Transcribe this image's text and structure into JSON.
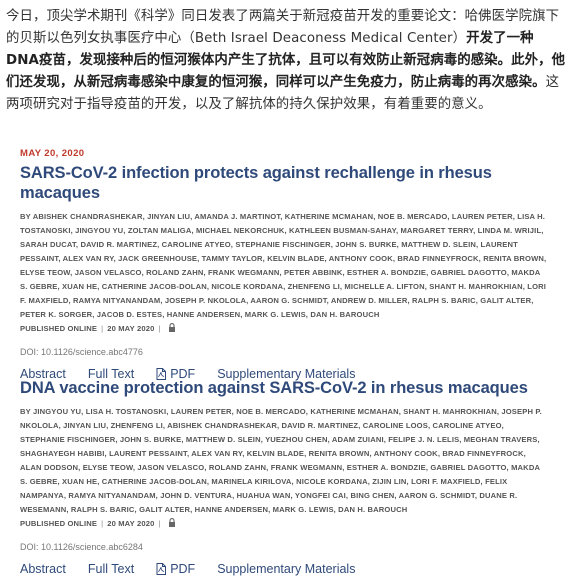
{
  "intro": {
    "part1": "今日，顶尖学术期刊《科学》同日发表了两篇关于新冠疫苗开发的重要论文：哈佛医学院旗下的贝斯以色列女执事医疗中心（Beth Israel Deaconess Medical Center）",
    "bold1": "开发了一种DNA疫苗，发现接种后的恒河猴体内产生了抗体，且可以有效防止新冠病毒的感染。此外，他们还发现，从新冠病毒感染中康复的恒河猴，同样可以产生免疫力，防止病毒的再次感染。",
    "part2": "这两项研究对于指导疫苗的开发，以及了解抗体的持久保护效果，有着重要的意义。"
  },
  "articles": [
    {
      "date": "MAY 20, 2020",
      "title": "SARS-CoV-2 infection protects against rechallenge in rhesus macaques",
      "authors": "BY ABISHEK CHANDRASHEKAR, JINYAN LIU, AMANDA J. MARTINOT, KATHERINE MCMAHAN, NOE B. MERCADO, LAUREN PETER, LISA H. TOSTANOSKI, JINGYOU YU, ZOLTAN MALIGA, MICHAEL NEKORCHUK, KATHLEEN BUSMAN-SAHAY, MARGARET TERRY, LINDA M. WRIJIL, SARAH DUCAT, DAVID R. MARTINEZ, CAROLINE ATYEO, STEPHANIE FISCHINGER, JOHN S. BURKE, MATTHEW D. SLEIN, LAURENT PESSAINT, ALEX VAN RY, JACK GREENHOUSE, TAMMY TAYLOR, KELVIN BLADE, ANTHONY COOK, BRAD FINNEYFROCK, RENITA BROWN, ELYSE TEOW, JASON VELASCO, ROLAND ZAHN, FRANK WEGMANN, PETER ABBINK, ESTHER A. BONDZIE, GABRIEL DAGOTTO, MAKDA S. GEBRE, XUAN HE, CATHERINE JACOB-DOLAN, NICOLE KORDANA, ZHENFENG LI, MICHELLE A. LIFTON, SHANT H. MAHROKHIAN, LORI F. MAXFIELD, RAMYA NITYANANDAM, JOSEPH P. NKOLOLA, AARON G. SCHMIDT, ANDREW D. MILLER, RALPH S. BARIC, GALIT ALTER, PETER K. SORGER, JACOB D. ESTES, HANNE ANDERSEN, MARK G. LEWIS, DAN H. BAROUCH",
      "published_label": "PUBLISHED ONLINE",
      "published_date": "20 MAY 2020",
      "doi": "DOI: 10.1126/science.abc4776",
      "links": {
        "abstract": "Abstract",
        "fulltext": "Full Text",
        "pdf": "PDF",
        "supp": "Supplementary Materials"
      }
    },
    {
      "title": "DNA vaccine protection against SARS-CoV-2 in rhesus macaques",
      "authors": "BY JINGYOU YU, LISA H. TOSTANOSKI, LAUREN PETER, NOE B. MERCADO, KATHERINE MCMAHAN, SHANT H. MAHROKHIAN, JOSEPH P. NKOLOLA, JINYAN LIU, ZHENFENG LI, ABISHEK CHANDRASHEKAR, DAVID R. MARTINEZ, CAROLINE LOOS, CAROLINE ATYEO, STEPHANIE FISCHINGER, JOHN S. BURKE, MATTHEW D. SLEIN, YUEZHOU CHEN, ADAM ZUIANI, FELIPE J. N. LELIS, MEGHAN TRAVERS, SHAGHAYEGH HABIBI, LAURENT PESSAINT, ALEX VAN RY, KELVIN BLADE, RENITA BROWN, ANTHONY COOK, BRAD FINNEYFROCK, ALAN DODSON, ELYSE TEOW, JASON VELASCO, ROLAND ZAHN, FRANK WEGMANN, ESTHER A. BONDZIE, GABRIEL DAGOTTO, MAKDA S. GEBRE, XUAN HE, CATHERINE JACOB-DOLAN, MARINELA KIRILOVA, NICOLE KORDANA, ZIJIN LIN, LORI F. MAXFIELD, FELIX NAMPANYA, RAMYA NITYANANDAM, JOHN D. VENTURA, HUAHUA WAN, YONGFEI CAI, BING CHEN, AARON G. SCHMIDT, DUANE R. WESEMANN, RALPH S. BARIC, GALIT ALTER, HANNE ANDERSEN, MARK G. LEWIS, DAN H. BAROUCH",
      "published_label": "PUBLISHED ONLINE",
      "published_date": "20 MAY 2020",
      "doi": "DOI: 10.1126/science.abc6284",
      "links": {
        "abstract": "Abstract",
        "fulltext": "Full Text",
        "pdf": "PDF",
        "supp": "Supplementary Materials"
      }
    }
  ]
}
